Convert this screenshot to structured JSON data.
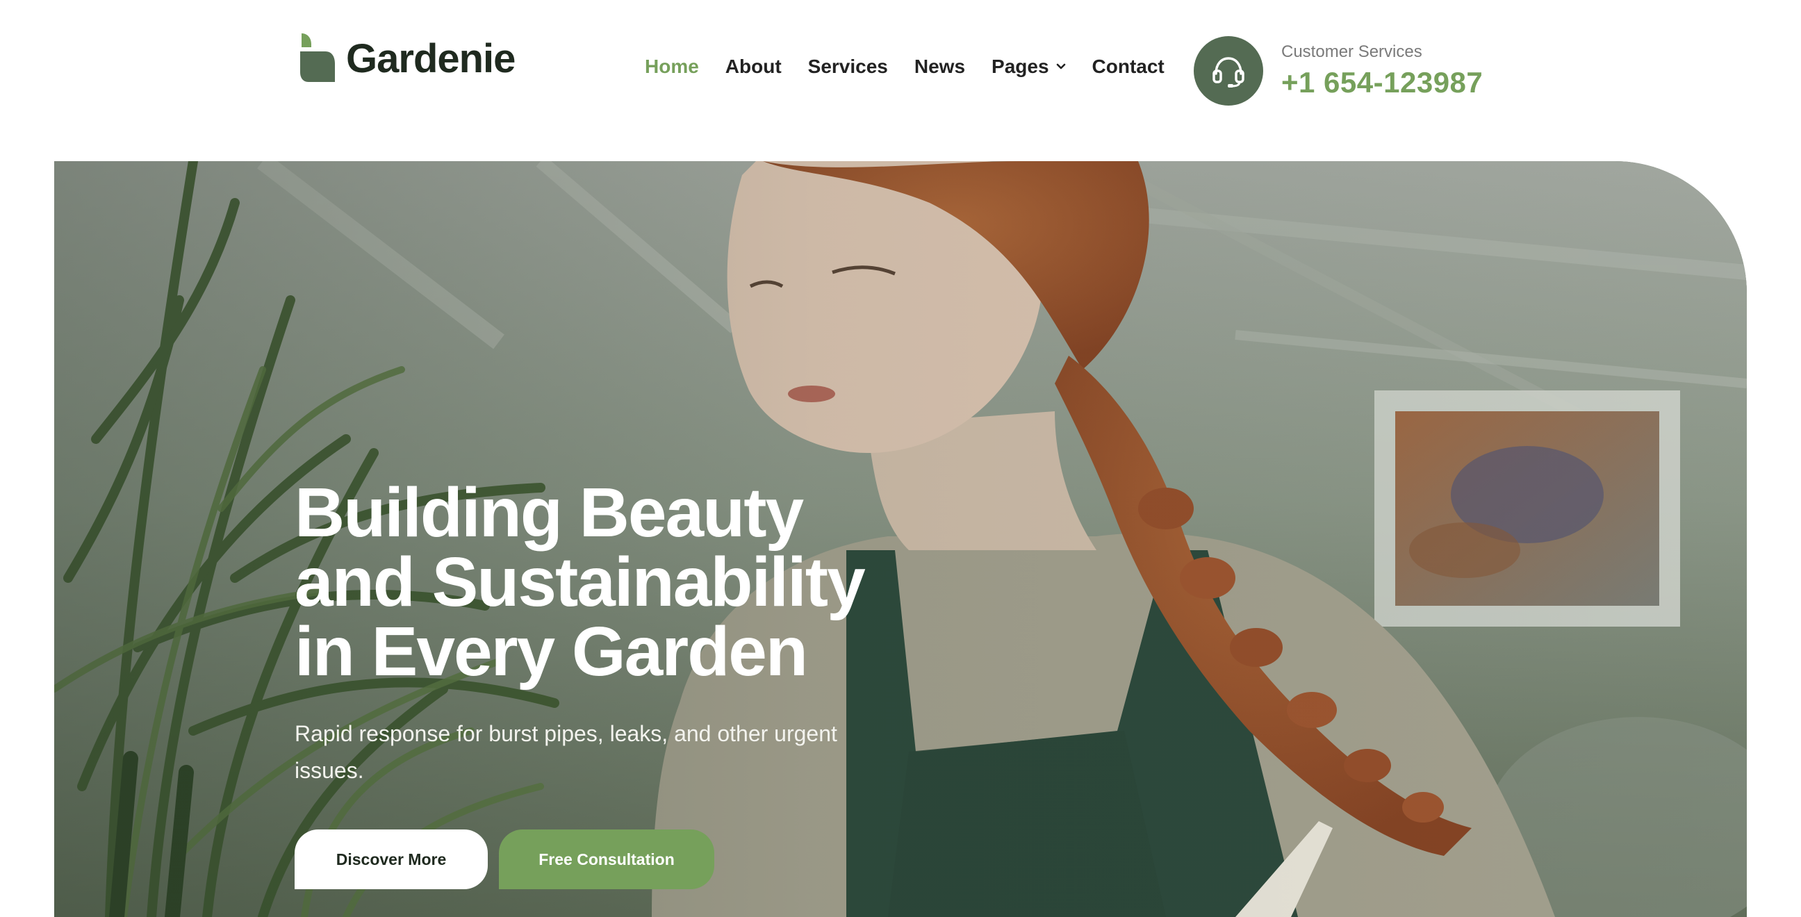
{
  "brand": {
    "name": "Gardenie",
    "accent_color": "#76a05b",
    "dark_green": "#546b53"
  },
  "nav": {
    "items": [
      {
        "label": "Home",
        "active": true
      },
      {
        "label": "About",
        "active": false
      },
      {
        "label": "Services",
        "active": false
      },
      {
        "label": "News",
        "active": false
      },
      {
        "label": "Pages",
        "active": false,
        "has_dropdown": true
      },
      {
        "label": "Contact",
        "active": false
      }
    ]
  },
  "support": {
    "label": "Customer Services",
    "phone": "+1 654-123987",
    "icon": "headset-icon"
  },
  "hero": {
    "title_lines": [
      "Building Beauty",
      "and Sustainability",
      "in Every Garden"
    ],
    "subtitle": "Rapid response for burst pipes, leaks, and other urgent issues.",
    "primary_button": "Discover More",
    "secondary_button": "Free Consultation"
  }
}
